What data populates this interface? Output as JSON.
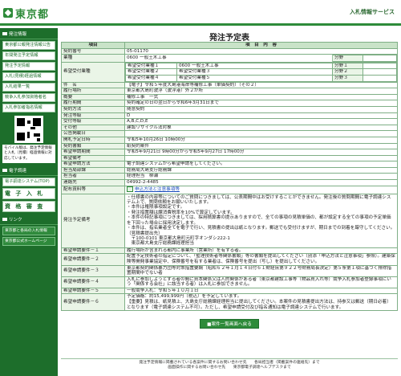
{
  "header": {
    "logo_text": "東京都",
    "site_title": "入札情報サービス"
  },
  "sidebar": {
    "section1": "発注情報",
    "items": [
      "東京都公報発注情報公告",
      "年間発注予定情報",
      "発注予定情報",
      "入札(見積)経過情報",
      "入札結果一覧",
      "競争入札参加資格者名",
      "入札参加者指名情報"
    ],
    "mobile_note": "モバイル版は、発注予定情報と入札（見積）経過情報に対応しています。",
    "section2": "電子調達",
    "system_link": "電子調達システム(TOP)",
    "big_items": [
      "電 子 入 札",
      "資 格 審 査"
    ],
    "section3": "リンク",
    "links": [
      "東京都と各局の入札情報",
      "東京都公式ホームページ"
    ]
  },
  "page": {
    "title": "発注予定表"
  },
  "table": {
    "head_item": "項目",
    "head_content": "項　目　内　容",
    "rows": [
      {
        "label": "契約番号",
        "value": "05-01170"
      },
      {
        "label": "業種",
        "value": "0600 一般土木工事"
      },
      {
        "label": "希望受付業種",
        "value": ""
      },
      {
        "label": "件　名",
        "value": "【電子】令和５年度大島港海岸等補修工事（単価契約）（その２）"
      },
      {
        "label": "履行場所",
        "value": "東京都大島町波浮（波浮港）外２か所"
      },
      {
        "label": "概要",
        "value": "補修工事　一式"
      },
      {
        "label": "履行期間",
        "value": "契約確定の日の翌日から令和6年3月31日まで"
      },
      {
        "label": "契約方法",
        "value": "随意契約"
      },
      {
        "label": "発注等級",
        "value": "D"
      },
      {
        "label": "受付等級",
        "value": "A,B,C,D,E"
      },
      {
        "label": "その他",
        "value": "建設リサイクル法対象"
      },
      {
        "label": "公告掲載日",
        "value": ""
      },
      {
        "label": "開札予定日時",
        "value": "令和5年10月26日 10時00分"
      },
      {
        "label": "契約書類",
        "value": "紙契約案件"
      },
      {
        "label": "希望申請期間",
        "value": "令和5年9月21日 9時00分から令和5年9月27日 17時00分"
      },
      {
        "label": "希望備考",
        "value": ""
      },
      {
        "label": "希望申請方法",
        "value": "電子調達システムから希望申請をしてください。"
      },
      {
        "label": "担当局部課",
        "value": "総務局大島支庁総務課"
      },
      {
        "label": "担当者",
        "value": "経理担当　柳瀬"
      },
      {
        "label": "連絡先",
        "value": "04992-2-4485"
      },
      {
        "label": "配布資料等",
        "value": "申込方法と注意事項等"
      },
      {
        "label": "発注予定備考",
        "value": "・仕様書の内容等についてのご質問につきましては、公表期間中はお受けすることができません。発注後の質問期間に電子調達システム上で、質問依頼をお願いいたします。\n・本件は権限事項設定です。\n・発注措置額は課消費税率を10%で算定しています。\n・本件の特記事項につきましては、採用積算書の提示ありますので、全ての事項の見積単価の、都が設定する全ての事項の予定単価を下回った場合に採用決定します。\n・本件は、指名業者全てを電子で行い、見積書の提出は紙となります。郵送でも受付けますが、期日までの到着を厳守してください。（見積書提出先）\n　〒100-0101 東京都大島町元町字オンダシ222-1\n　東京都大島支庁総務課経理担当"
      },
      {
        "label": "希望申請要件－１",
        "value": "履行場所が含まれる都内に事業所（営業所）を有する者。"
      },
      {
        "label": "希望申請要件－２",
        "value": "配置予定技術者の指定について、「監理技術者等関係書類」等の書類を提出してください（別添「申込方法と注意事項」参照）。建築保険等開発事業協定中、保険番号を有する業者は、保険番号を提出（写し）を提出してください。"
      },
      {
        "label": "希望申請要件－３",
        "value": "東京都契約関係暴力団等対策措置要綱（昭和６２年１月１４日付６１財経庶第９２２号財務局長決定）第５条第１項に基づく排除措置期間中でない者"
      },
      {
        "label": "希望申請要件－４",
        "value": "入札に参加しようとする者の間に資本関係又は人的関係がある者（東京都建設工事等（物品買入れ等）競争入札参加者登録事項にいう「関係する会社」に該当する者）は入札に参加できません。"
      },
      {
        "label": "希望申請要件－５",
        "value": "一般競争入札：令和５年１０月１日"
      },
      {
        "label": "希望申請要件－６",
        "value": "予定価格：約15,499,999円（税込）を予定しています。\n【重要】見積は、紙見積上、大島支庁総務課経理担当に提出してください。本案件の見積書提出方法は、持参又は郵送（期日必着）となります（電子調達システム不可）。ただし、希望申請受付及び指名通知は電子調達システムで行います。"
      }
    ],
    "gyoshu_sub": [
      {
        "a": "0600 一般土木工事",
        "b": "0600 一般土木工事"
      }
    ],
    "kibou_sub": [
      {
        "a": "希望受付業種１",
        "b": "0600 一般土木工事"
      },
      {
        "a": "希望受付業種２",
        "b": "希望受付業種３"
      },
      {
        "a": "希望受付業種４",
        "b": "希望受付業種５"
      }
    ],
    "bunya": [
      "分野",
      "分野１",
      "分野２",
      "分野３"
    ]
  },
  "buttons": {
    "back": "■案件一覧画面へ戻る"
  },
  "footer": {
    "line1": "発注予定情報に掲載されている各案件に関するお問い合わせ先　　各局担当者（掲載案件の連絡先）まで",
    "line2": "画面操作に関するお問い合わせ先　　東京都電子調達ヘルプデスクまで"
  }
}
